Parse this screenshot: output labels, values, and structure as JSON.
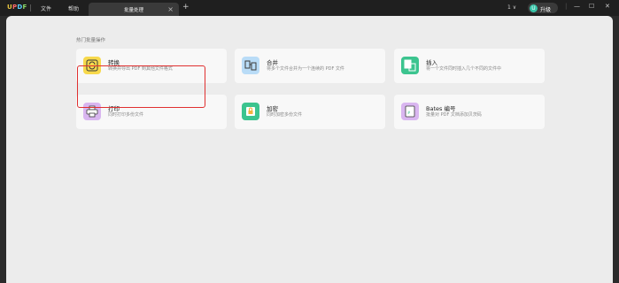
{
  "app": {
    "logo": [
      "U",
      "P",
      "D",
      "F"
    ]
  },
  "menu": {
    "file": "文件",
    "help": "帮助"
  },
  "tabs": [
    {
      "label": "批量处理",
      "close": "×"
    }
  ],
  "new_tab": "+",
  "toolbar": {
    "page_indicator": "1 ∨",
    "upgrade_label": "升级",
    "avatar_letter": "U"
  },
  "window_controls": {
    "separator": "|",
    "minimize": "—",
    "maximize": "☐",
    "close": "✕"
  },
  "main": {
    "section_title": "热门批量操作",
    "cards": [
      {
        "name": "转换",
        "desc": "转换并导出 PDF 到其他文件格式",
        "icon": "convert-icon",
        "color": "#f7d94c"
      },
      {
        "name": "合并",
        "desc": "将多个文件合并为一个连续的 PDF 文件",
        "icon": "merge-icon",
        "color": "#b9dcf7"
      },
      {
        "name": "插入",
        "desc": "将一个文件同时插入几个不同的文件中",
        "icon": "insert-icon",
        "color": "#3cc48f"
      },
      {
        "name": "打印",
        "desc": "同时打印多份文件",
        "icon": "print-icon",
        "color": "#d9b6f0"
      },
      {
        "name": "加密",
        "desc": "同时加密多份文件",
        "icon": "lock-icon",
        "color": "#3cc48f"
      },
      {
        "name": "Bates 编号",
        "desc": "批量对 PDF 文档添加贝茨码",
        "icon": "bates-icon",
        "color": "#d9b6f0"
      }
    ]
  }
}
